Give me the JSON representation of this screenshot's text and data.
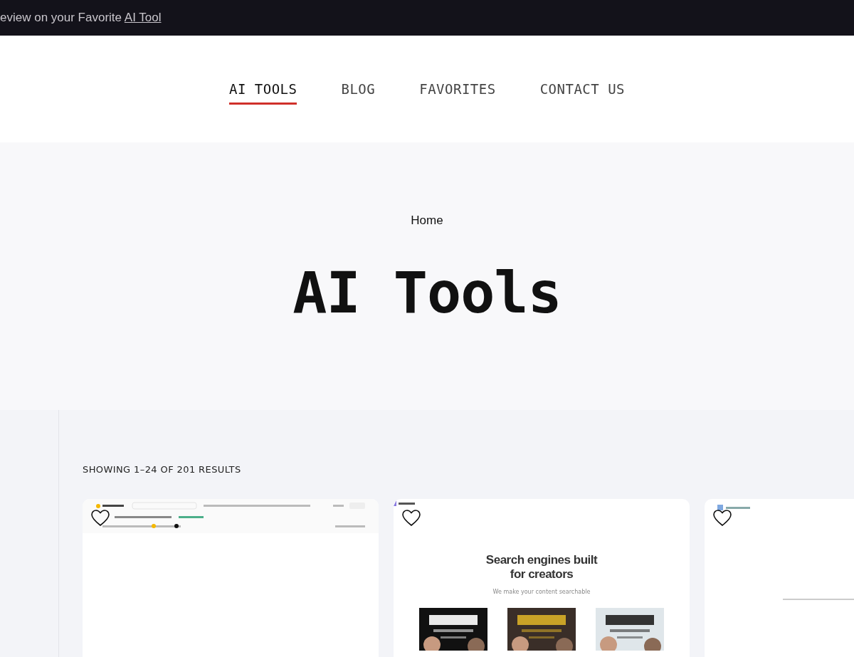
{
  "announcement": {
    "text": "eview on your Favorite",
    "link": "AI Tool"
  },
  "nav": [
    {
      "label": "AI TOOLS",
      "selected": true
    },
    {
      "label": "BLOG",
      "selected": false
    },
    {
      "label": "FAVORITES",
      "selected": false
    },
    {
      "label": "CONTACT US",
      "selected": false
    }
  ],
  "hero": {
    "breadcrumb": "Home",
    "title": "AI Tools"
  },
  "results": {
    "count": "SHOWING 1–24 OF 201 RESULTS"
  },
  "cards": [
    {
      "kind": "app-header",
      "favorite": false
    },
    {
      "kind": "landing",
      "favorite": false,
      "heading": "Search engines built for creators",
      "subheading": "We make your content searchable"
    },
    {
      "kind": "blank",
      "favorite": false
    }
  ]
}
